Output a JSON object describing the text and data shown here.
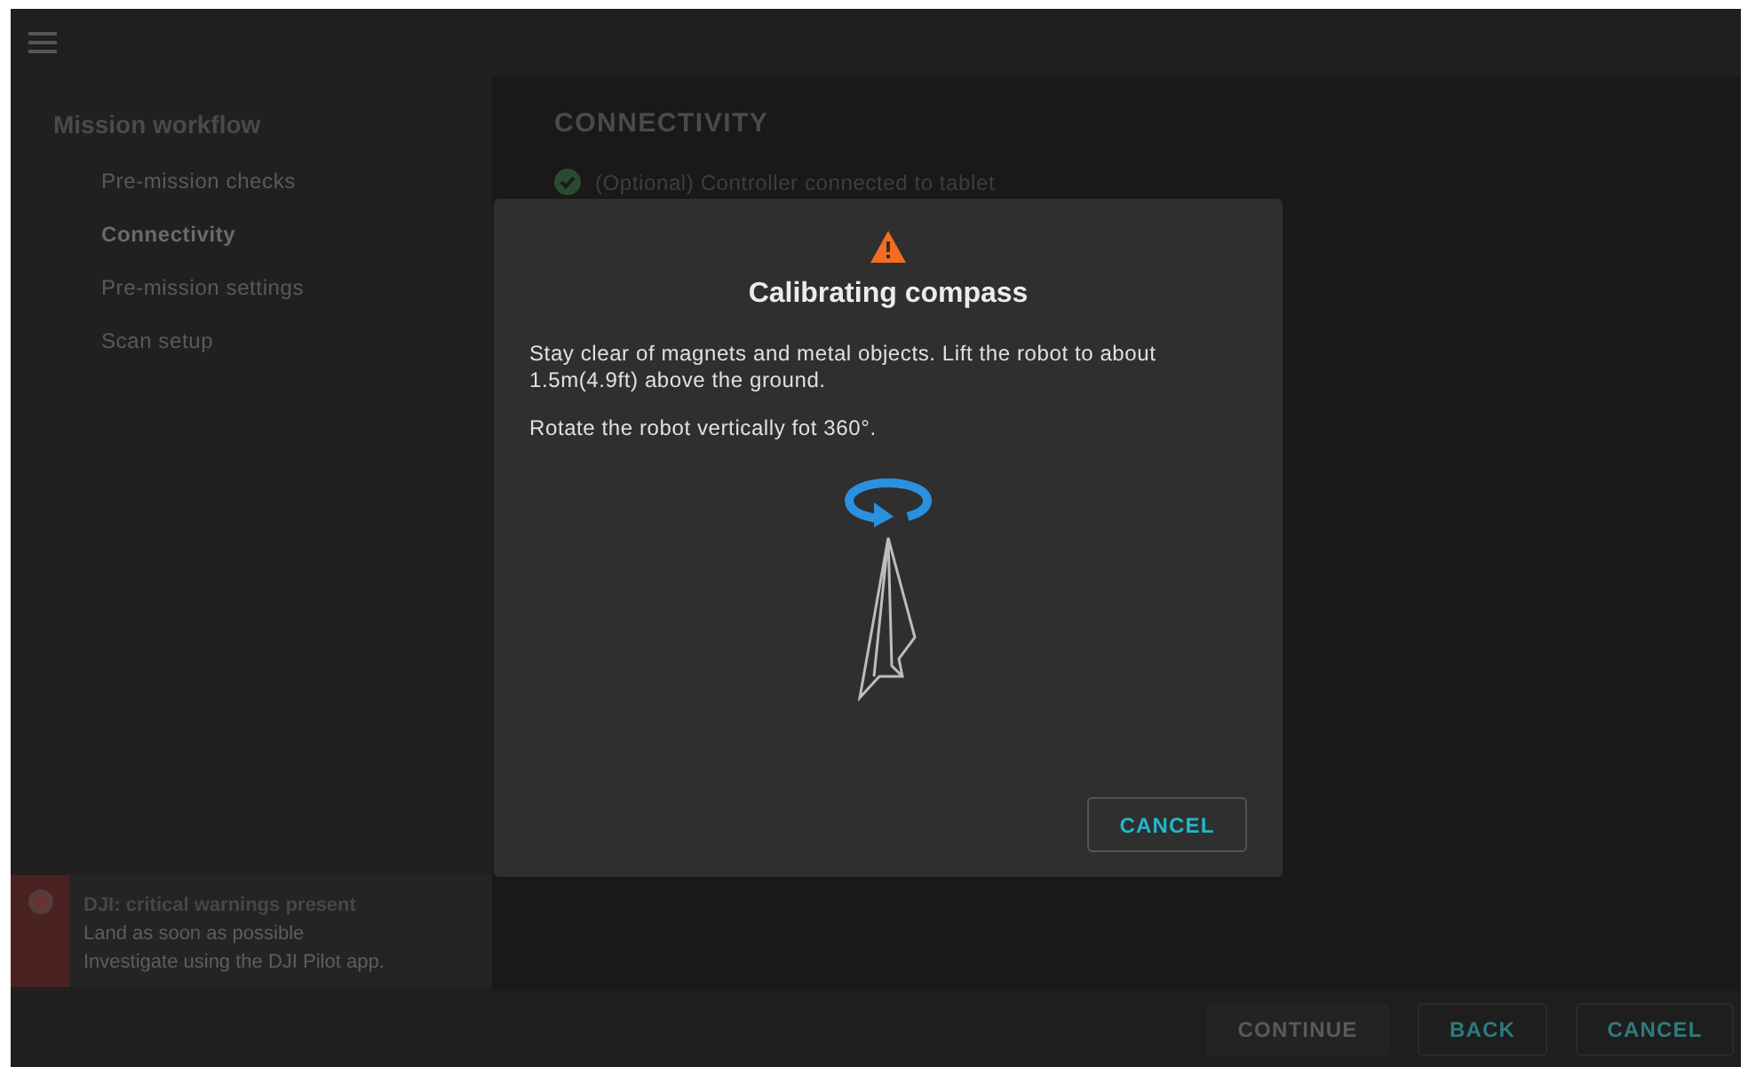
{
  "sidebar": {
    "title": "Mission workflow",
    "items": [
      {
        "label": "Pre-mission checks",
        "selected": false
      },
      {
        "label": "Connectivity",
        "selected": true
      },
      {
        "label": "Pre-mission settings",
        "selected": false
      },
      {
        "label": "Scan setup",
        "selected": false
      }
    ]
  },
  "alert": {
    "title": "DJI: critical warnings present",
    "lines": [
      "Land as soon as possible",
      "Investigate using the DJI Pilot app."
    ]
  },
  "main": {
    "heading": "CONNECTIVITY",
    "checks": [
      {
        "label": "(Optional) Controller connected to tablet",
        "checked": true
      }
    ]
  },
  "footer": {
    "buttons": [
      {
        "label": "CONTINUE",
        "disabled": true
      },
      {
        "label": "BACK",
        "disabled": false
      },
      {
        "label": "CANCEL",
        "disabled": false
      }
    ]
  },
  "dialog": {
    "title": "Calibrating compass",
    "paragraphs": [
      "Stay clear of magnets and metal objects. Lift the robot to about 1.5m(4.9ft) above the ground.",
      "Rotate the robot vertically fot 360°."
    ],
    "button": "CANCEL"
  }
}
